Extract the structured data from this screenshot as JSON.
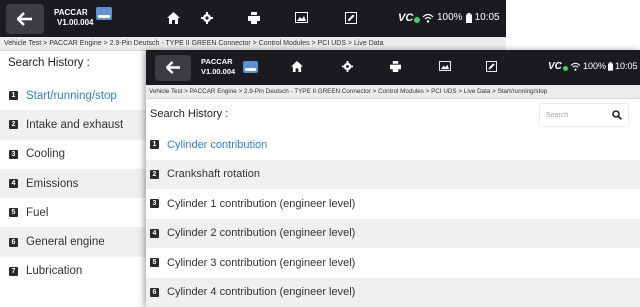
{
  "app": {
    "brand": "PACCAR",
    "version": "V1.00.004",
    "vci_label": "VC",
    "battery": "100%",
    "time": "10:05"
  },
  "back_panel": {
    "breadcrumb": "Vehicle Test > PACCAR Engine > 2.9-Pin Deutsch - TYPE II GREEN Connector > Control Modules > PCI UDS > Live Data",
    "history_title": "Search History :",
    "items": [
      {
        "num": "1",
        "label": "Start/running/stop"
      },
      {
        "num": "2",
        "label": "Intake and exhaust"
      },
      {
        "num": "3",
        "label": "Cooling"
      },
      {
        "num": "4",
        "label": "Emissions"
      },
      {
        "num": "5",
        "label": "Fuel"
      },
      {
        "num": "6",
        "label": "General engine"
      },
      {
        "num": "7",
        "label": "Lubrication"
      }
    ]
  },
  "front_panel": {
    "breadcrumb": "Vehicle Test > PACCAR Engine > 2.9-Pin Deutsch - TYPE II GREEN Connector > Control Modules > PCI UDS > Live Data > Start/running/stop",
    "history_title": "Search History :",
    "search_placeholder": "Search",
    "items": [
      {
        "num": "1",
        "label": "Cylinder contribution"
      },
      {
        "num": "2",
        "label": "Crankshaft rotation"
      },
      {
        "num": "3",
        "label": "Cylinder 1 contribution (engineer level)"
      },
      {
        "num": "4",
        "label": "Cylinder 2 contribution (engineer level)"
      },
      {
        "num": "5",
        "label": "Cylinder 3 contribution (engineer level)"
      },
      {
        "num": "6",
        "label": "Cylinder 4 contribution (engineer level)"
      }
    ]
  },
  "colors": {
    "topbar": "#1b1b1f",
    "accent": "#2e7fd8",
    "vci_connected": "#3ed35a"
  },
  "icons": [
    "back-arrow-icon",
    "vci-badge-icon",
    "home-icon",
    "settings-icon",
    "print-icon",
    "image-icon",
    "edit-icon",
    "wifi-icon",
    "battery-icon",
    "search-icon"
  ]
}
